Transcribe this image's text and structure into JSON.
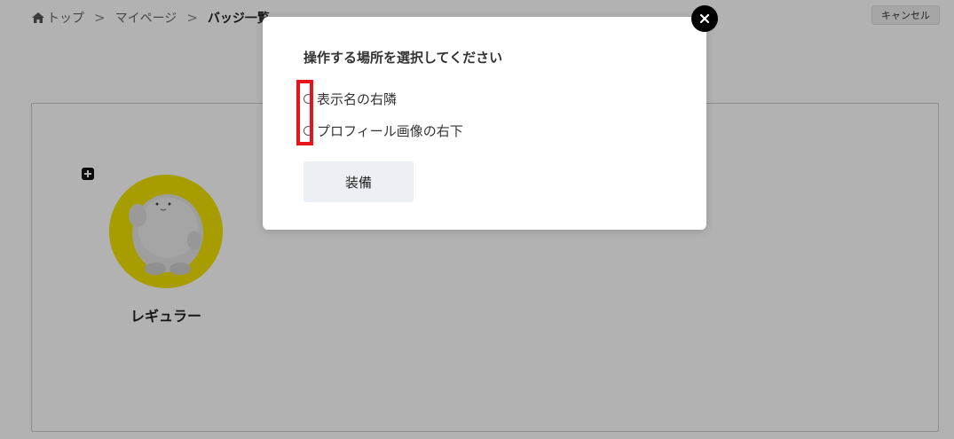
{
  "breadcrumb": {
    "home_icon": "home-icon",
    "items": [
      "トップ",
      "マイページ",
      "バッジ一覧"
    ],
    "separator": ">"
  },
  "header": {
    "cancel_label": "キャンセル"
  },
  "badge": {
    "name": "レギュラー",
    "add_icon": "plus-square-icon",
    "ring_color": "#f0e000"
  },
  "modal": {
    "title": "操作する場所を選択してください",
    "options": [
      {
        "label": "表示名の右隣",
        "selected": false
      },
      {
        "label": "プロフィール画像の右下",
        "selected": false
      }
    ],
    "equip_label": "装備",
    "close_icon": "close-icon",
    "highlight_color": "#e8141b"
  }
}
